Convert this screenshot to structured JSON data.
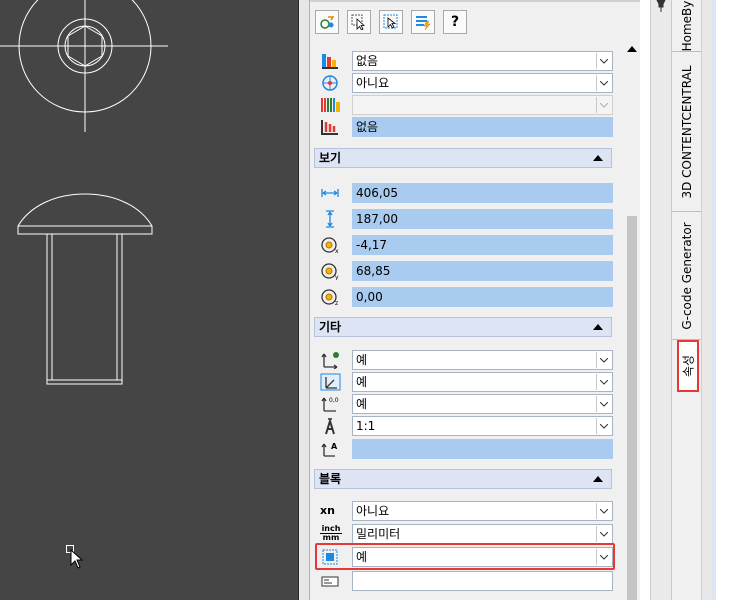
{
  "toolbar": {
    "buttons": [
      {
        "icon": "quick-select-icon"
      },
      {
        "icon": "select-objects-icon"
      },
      {
        "icon": "toggle-pickadd-icon"
      },
      {
        "icon": "quick-calc-icon"
      },
      {
        "icon": "help-icon",
        "label": "?"
      }
    ]
  },
  "top_rows": [
    {
      "icon": "material-icon",
      "value": "없음",
      "type": "dropdown"
    },
    {
      "icon": "shadow-display-icon",
      "value": "아니요",
      "type": "dropdown"
    },
    {
      "icon": "plot-style-icon",
      "value": "",
      "type": "disabled"
    },
    {
      "icon": "plot-style-table-icon",
      "value": "없음",
      "type": "blue"
    }
  ],
  "view": {
    "title": "보기",
    "rows": [
      {
        "icon": "width-icon",
        "value": "406,05"
      },
      {
        "icon": "height-icon",
        "value": "187,00"
      },
      {
        "icon": "center-x-icon",
        "value": "-4,17"
      },
      {
        "icon": "center-y-icon",
        "value": "68,85"
      },
      {
        "icon": "center-z-icon",
        "value": "0,00"
      }
    ]
  },
  "misc": {
    "title": "기타",
    "rows": [
      {
        "icon": "ucs-icon-on-icon",
        "value": "예",
        "type": "dropdown"
      },
      {
        "icon": "ucs-at-origin-icon",
        "value": "예",
        "type": "dropdown"
      },
      {
        "icon": "ucs-per-viewport-icon",
        "value": "예",
        "type": "dropdown"
      },
      {
        "icon": "annotation-scale-icon",
        "value": "1:1",
        "type": "dropdown"
      },
      {
        "icon": "ucs-name-icon",
        "value": "",
        "type": "blue"
      }
    ]
  },
  "block": {
    "title": "블록",
    "rows": [
      {
        "icon": "xn-icon",
        "icon_label": "xn",
        "value": "아니요",
        "type": "dropdown"
      },
      {
        "icon": "inch-mm-icon",
        "icon_label_top": "inch",
        "icon_label_bottom": "mm",
        "value": "밀리미터",
        "type": "dropdown"
      },
      {
        "icon": "block-explode-icon",
        "value": "예",
        "type": "dropdown",
        "highlighted": true
      },
      {
        "icon": "block-description-icon",
        "value": "",
        "type": "plain"
      }
    ]
  },
  "side_tabs": [
    {
      "label": "HomeBy"
    },
    {
      "label": "3D CONTENTCENTRAL"
    },
    {
      "label": "G-code Generator"
    },
    {
      "label": "속성",
      "active": true
    }
  ],
  "colors": {
    "canvas": "#454545",
    "highlight": "#e53935",
    "field_blue": "#a9cbef",
    "section": "#dde4f4"
  }
}
